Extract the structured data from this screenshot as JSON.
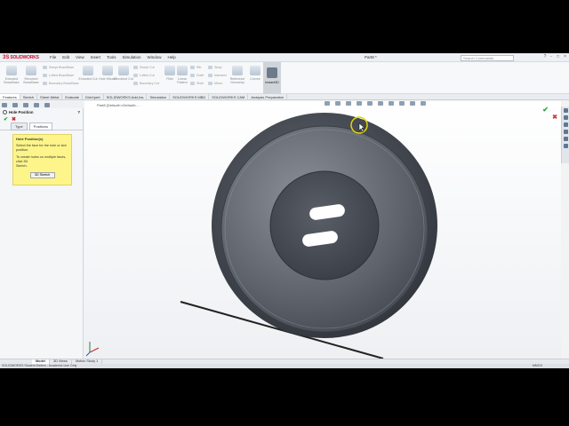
{
  "app": {
    "logo_ds": "3S",
    "logo_text": "SOLIDWORKS",
    "doc_title": "Part8 *",
    "search_placeholder": "Search Commands"
  },
  "menus": [
    "File",
    "Edit",
    "View",
    "Insert",
    "Tools",
    "Simulation",
    "Window",
    "Help"
  ],
  "window_controls": [
    "?",
    "-",
    "□",
    "×"
  ],
  "command_manager": {
    "big_buttons": [
      "Extruded Boss/Base",
      "Revolved Boss/Base",
      "Extruded Cut",
      "Hole Wizard",
      "Revolved Cut",
      "Fillet",
      "Linear Pattern",
      "Rib",
      "Reference Geometry",
      "Curves"
    ],
    "small_buttons": [
      "Swept Boss/Base",
      "Lofted Boss/Base",
      "Boundary Boss/Base",
      "Swept Cut",
      "Lofted Cut",
      "Boundary Cut",
      "Draft",
      "Intersect",
      "Shell",
      "Mirror",
      "Wrap"
    ],
    "sketch3d_label": "Instant3D"
  },
  "tabs": [
    "Features",
    "Sketch",
    "Sheet Metal",
    "Evaluate",
    "DimXpert",
    "SOLIDWORKS Add-Ins",
    "Simulation",
    "SOLIDWORKS MBD",
    "SOLIDWORKS CAM",
    "Analysis Preparation"
  ],
  "panel": {
    "title": "Hole Position",
    "help": "?",
    "ok": "✔",
    "cancel": "✖",
    "tabs": [
      "Type",
      "Positions"
    ],
    "message_title": "Hole Position(s)",
    "message_lines": [
      "Select the face for the hole or slot",
      "position.",
      "",
      "To create holes on multiple faces, click 3D",
      "Sketch."
    ],
    "button_3d": "3D Sketch"
  },
  "graphics": {
    "breadcrumb": "Part8 (Default<<Default>...",
    "confirm_ok": "✔",
    "confirm_cancel": "✖"
  },
  "bottom_tabs": [
    "Model",
    "3D Views",
    "Motion Study 1"
  ],
  "status": {
    "left": "SOLIDWORKS Student Edition - Academic Use Only",
    "right": "MMGS"
  }
}
